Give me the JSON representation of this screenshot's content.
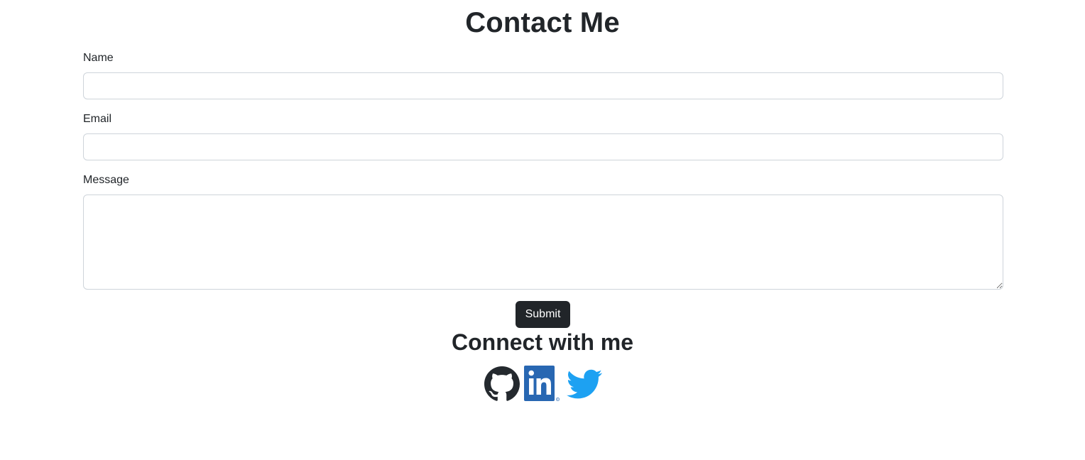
{
  "page": {
    "title": "Contact Me"
  },
  "form": {
    "name_label": "Name",
    "name_value": "",
    "email_label": "Email",
    "email_value": "",
    "message_label": "Message",
    "message_value": "",
    "submit_label": "Submit"
  },
  "social": {
    "title": "Connect with me",
    "links": [
      {
        "icon": "github-icon",
        "color": "#24292e"
      },
      {
        "icon": "linkedin-icon",
        "color": "#2867b2"
      },
      {
        "icon": "twitter-icon",
        "color": "#1da1f2"
      }
    ]
  },
  "colors": {
    "text": "#212529",
    "button_bg": "#212529",
    "input_border": "#ced4da"
  }
}
